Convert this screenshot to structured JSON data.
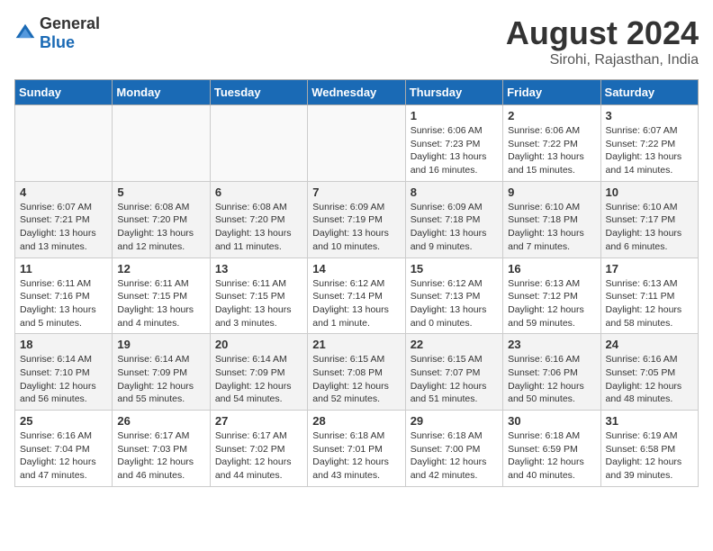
{
  "logo": {
    "general": "General",
    "blue": "Blue"
  },
  "title": {
    "month": "August 2024",
    "location": "Sirohi, Rajasthan, India"
  },
  "headers": [
    "Sunday",
    "Monday",
    "Tuesday",
    "Wednesday",
    "Thursday",
    "Friday",
    "Saturday"
  ],
  "weeks": [
    [
      {
        "day": "",
        "info": ""
      },
      {
        "day": "",
        "info": ""
      },
      {
        "day": "",
        "info": ""
      },
      {
        "day": "",
        "info": ""
      },
      {
        "day": "1",
        "info": "Sunrise: 6:06 AM\nSunset: 7:23 PM\nDaylight: 13 hours\nand 16 minutes."
      },
      {
        "day": "2",
        "info": "Sunrise: 6:06 AM\nSunset: 7:22 PM\nDaylight: 13 hours\nand 15 minutes."
      },
      {
        "day": "3",
        "info": "Sunrise: 6:07 AM\nSunset: 7:22 PM\nDaylight: 13 hours\nand 14 minutes."
      }
    ],
    [
      {
        "day": "4",
        "info": "Sunrise: 6:07 AM\nSunset: 7:21 PM\nDaylight: 13 hours\nand 13 minutes."
      },
      {
        "day": "5",
        "info": "Sunrise: 6:08 AM\nSunset: 7:20 PM\nDaylight: 13 hours\nand 12 minutes."
      },
      {
        "day": "6",
        "info": "Sunrise: 6:08 AM\nSunset: 7:20 PM\nDaylight: 13 hours\nand 11 minutes."
      },
      {
        "day": "7",
        "info": "Sunrise: 6:09 AM\nSunset: 7:19 PM\nDaylight: 13 hours\nand 10 minutes."
      },
      {
        "day": "8",
        "info": "Sunrise: 6:09 AM\nSunset: 7:18 PM\nDaylight: 13 hours\nand 9 minutes."
      },
      {
        "day": "9",
        "info": "Sunrise: 6:10 AM\nSunset: 7:18 PM\nDaylight: 13 hours\nand 7 minutes."
      },
      {
        "day": "10",
        "info": "Sunrise: 6:10 AM\nSunset: 7:17 PM\nDaylight: 13 hours\nand 6 minutes."
      }
    ],
    [
      {
        "day": "11",
        "info": "Sunrise: 6:11 AM\nSunset: 7:16 PM\nDaylight: 13 hours\nand 5 minutes."
      },
      {
        "day": "12",
        "info": "Sunrise: 6:11 AM\nSunset: 7:15 PM\nDaylight: 13 hours\nand 4 minutes."
      },
      {
        "day": "13",
        "info": "Sunrise: 6:11 AM\nSunset: 7:15 PM\nDaylight: 13 hours\nand 3 minutes."
      },
      {
        "day": "14",
        "info": "Sunrise: 6:12 AM\nSunset: 7:14 PM\nDaylight: 13 hours\nand 1 minute."
      },
      {
        "day": "15",
        "info": "Sunrise: 6:12 AM\nSunset: 7:13 PM\nDaylight: 13 hours\nand 0 minutes."
      },
      {
        "day": "16",
        "info": "Sunrise: 6:13 AM\nSunset: 7:12 PM\nDaylight: 12 hours\nand 59 minutes."
      },
      {
        "day": "17",
        "info": "Sunrise: 6:13 AM\nSunset: 7:11 PM\nDaylight: 12 hours\nand 58 minutes."
      }
    ],
    [
      {
        "day": "18",
        "info": "Sunrise: 6:14 AM\nSunset: 7:10 PM\nDaylight: 12 hours\nand 56 minutes."
      },
      {
        "day": "19",
        "info": "Sunrise: 6:14 AM\nSunset: 7:09 PM\nDaylight: 12 hours\nand 55 minutes."
      },
      {
        "day": "20",
        "info": "Sunrise: 6:14 AM\nSunset: 7:09 PM\nDaylight: 12 hours\nand 54 minutes."
      },
      {
        "day": "21",
        "info": "Sunrise: 6:15 AM\nSunset: 7:08 PM\nDaylight: 12 hours\nand 52 minutes."
      },
      {
        "day": "22",
        "info": "Sunrise: 6:15 AM\nSunset: 7:07 PM\nDaylight: 12 hours\nand 51 minutes."
      },
      {
        "day": "23",
        "info": "Sunrise: 6:16 AM\nSunset: 7:06 PM\nDaylight: 12 hours\nand 50 minutes."
      },
      {
        "day": "24",
        "info": "Sunrise: 6:16 AM\nSunset: 7:05 PM\nDaylight: 12 hours\nand 48 minutes."
      }
    ],
    [
      {
        "day": "25",
        "info": "Sunrise: 6:16 AM\nSunset: 7:04 PM\nDaylight: 12 hours\nand 47 minutes."
      },
      {
        "day": "26",
        "info": "Sunrise: 6:17 AM\nSunset: 7:03 PM\nDaylight: 12 hours\nand 46 minutes."
      },
      {
        "day": "27",
        "info": "Sunrise: 6:17 AM\nSunset: 7:02 PM\nDaylight: 12 hours\nand 44 minutes."
      },
      {
        "day": "28",
        "info": "Sunrise: 6:18 AM\nSunset: 7:01 PM\nDaylight: 12 hours\nand 43 minutes."
      },
      {
        "day": "29",
        "info": "Sunrise: 6:18 AM\nSunset: 7:00 PM\nDaylight: 12 hours\nand 42 minutes."
      },
      {
        "day": "30",
        "info": "Sunrise: 6:18 AM\nSunset: 6:59 PM\nDaylight: 12 hours\nand 40 minutes."
      },
      {
        "day": "31",
        "info": "Sunrise: 6:19 AM\nSunset: 6:58 PM\nDaylight: 12 hours\nand 39 minutes."
      }
    ]
  ]
}
